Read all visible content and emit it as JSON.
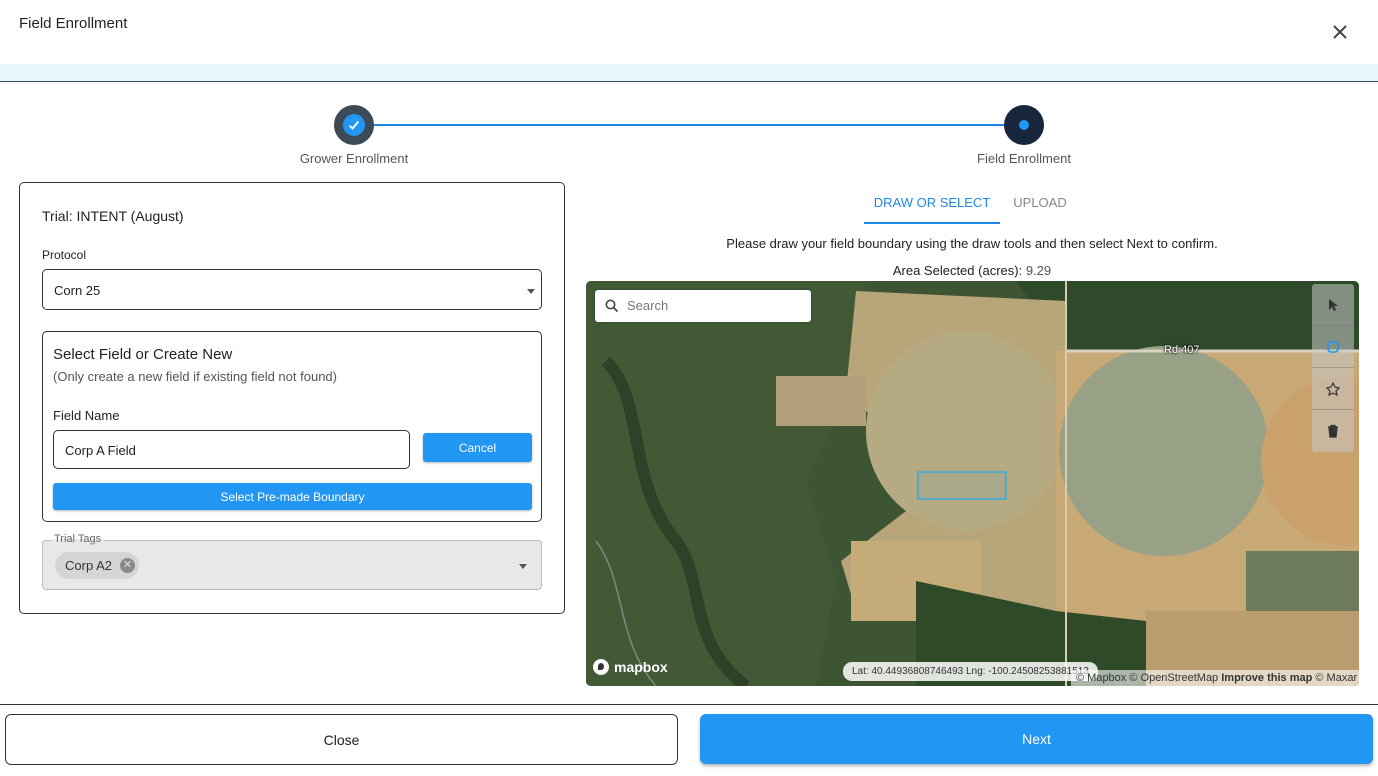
{
  "header": {
    "title": "Field Enrollment",
    "close_icon": "close-icon"
  },
  "stepper": {
    "steps": [
      {
        "label": "Grower Enrollment",
        "state": "completed"
      },
      {
        "label": "Field Enrollment",
        "state": "active"
      }
    ]
  },
  "form": {
    "trial_title": "Trial: INTENT (August)",
    "protocol_label": "Protocol",
    "protocol_value": "Corn 25",
    "field_section": {
      "title": "Select Field or Create New",
      "subtitle": "(Only create a new field if existing field not found)",
      "field_name_label": "Field Name",
      "field_name_value": "Corp A Field",
      "cancel_label": "Cancel",
      "premade_label": "Select Pre-made Boundary"
    },
    "tags": {
      "legend": "Trial Tags",
      "chips": [
        "Corp A2"
      ]
    }
  },
  "map_panel": {
    "tabs": [
      {
        "label": "DRAW OR SELECT",
        "active": true
      },
      {
        "label": "UPLOAD",
        "active": false
      }
    ],
    "instructions": "Please draw your field boundary using the draw tools and then select Next to confirm.",
    "area_label": "Area Selected (acres):",
    "area_value": "9.29",
    "search_placeholder": "Search",
    "road_label": "Rd 407",
    "logo_text": "mapbox",
    "coords": "Lat: 40.44936808746493 Lng: -100.24508253881513",
    "attribution": {
      "mapbox": "© Mapbox",
      "osm": "© OpenStreetMap",
      "improve": "Improve this map",
      "maxar": "© Maxar"
    },
    "tools": [
      "pointer-icon",
      "polygon-icon",
      "pin-icon",
      "trash-icon"
    ]
  },
  "footer": {
    "close_label": "Close",
    "next_label": "Next"
  },
  "colors": {
    "accent": "#2196f3",
    "step_dark": "#17263a",
    "banner": "#e8f5fd"
  }
}
